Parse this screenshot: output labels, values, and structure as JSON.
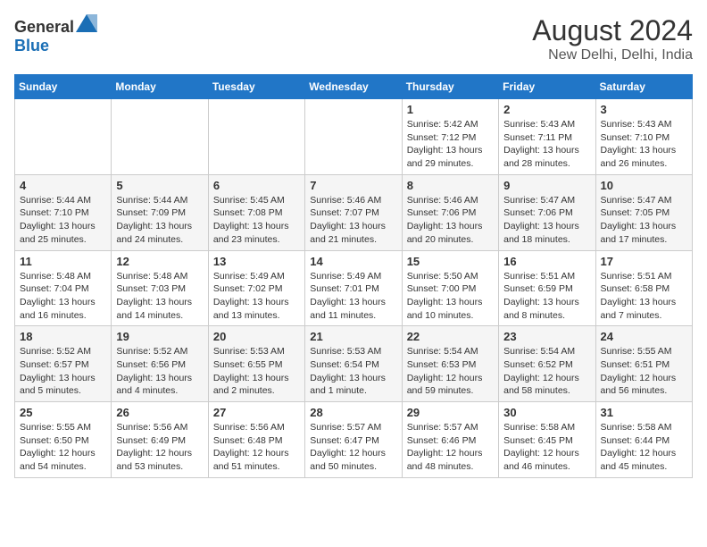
{
  "header": {
    "logo_general": "General",
    "logo_blue": "Blue",
    "title": "August 2024",
    "subtitle": "New Delhi, Delhi, India"
  },
  "columns": [
    "Sunday",
    "Monday",
    "Tuesday",
    "Wednesday",
    "Thursday",
    "Friday",
    "Saturday"
  ],
  "weeks": [
    [
      {
        "day": "",
        "info": ""
      },
      {
        "day": "",
        "info": ""
      },
      {
        "day": "",
        "info": ""
      },
      {
        "day": "",
        "info": ""
      },
      {
        "day": "1",
        "info": "Sunrise: 5:42 AM\nSunset: 7:12 PM\nDaylight: 13 hours\nand 29 minutes."
      },
      {
        "day": "2",
        "info": "Sunrise: 5:43 AM\nSunset: 7:11 PM\nDaylight: 13 hours\nand 28 minutes."
      },
      {
        "day": "3",
        "info": "Sunrise: 5:43 AM\nSunset: 7:10 PM\nDaylight: 13 hours\nand 26 minutes."
      }
    ],
    [
      {
        "day": "4",
        "info": "Sunrise: 5:44 AM\nSunset: 7:10 PM\nDaylight: 13 hours\nand 25 minutes."
      },
      {
        "day": "5",
        "info": "Sunrise: 5:44 AM\nSunset: 7:09 PM\nDaylight: 13 hours\nand 24 minutes."
      },
      {
        "day": "6",
        "info": "Sunrise: 5:45 AM\nSunset: 7:08 PM\nDaylight: 13 hours\nand 23 minutes."
      },
      {
        "day": "7",
        "info": "Sunrise: 5:46 AM\nSunset: 7:07 PM\nDaylight: 13 hours\nand 21 minutes."
      },
      {
        "day": "8",
        "info": "Sunrise: 5:46 AM\nSunset: 7:06 PM\nDaylight: 13 hours\nand 20 minutes."
      },
      {
        "day": "9",
        "info": "Sunrise: 5:47 AM\nSunset: 7:06 PM\nDaylight: 13 hours\nand 18 minutes."
      },
      {
        "day": "10",
        "info": "Sunrise: 5:47 AM\nSunset: 7:05 PM\nDaylight: 13 hours\nand 17 minutes."
      }
    ],
    [
      {
        "day": "11",
        "info": "Sunrise: 5:48 AM\nSunset: 7:04 PM\nDaylight: 13 hours\nand 16 minutes."
      },
      {
        "day": "12",
        "info": "Sunrise: 5:48 AM\nSunset: 7:03 PM\nDaylight: 13 hours\nand 14 minutes."
      },
      {
        "day": "13",
        "info": "Sunrise: 5:49 AM\nSunset: 7:02 PM\nDaylight: 13 hours\nand 13 minutes."
      },
      {
        "day": "14",
        "info": "Sunrise: 5:49 AM\nSunset: 7:01 PM\nDaylight: 13 hours\nand 11 minutes."
      },
      {
        "day": "15",
        "info": "Sunrise: 5:50 AM\nSunset: 7:00 PM\nDaylight: 13 hours\nand 10 minutes."
      },
      {
        "day": "16",
        "info": "Sunrise: 5:51 AM\nSunset: 6:59 PM\nDaylight: 13 hours\nand 8 minutes."
      },
      {
        "day": "17",
        "info": "Sunrise: 5:51 AM\nSunset: 6:58 PM\nDaylight: 13 hours\nand 7 minutes."
      }
    ],
    [
      {
        "day": "18",
        "info": "Sunrise: 5:52 AM\nSunset: 6:57 PM\nDaylight: 13 hours\nand 5 minutes."
      },
      {
        "day": "19",
        "info": "Sunrise: 5:52 AM\nSunset: 6:56 PM\nDaylight: 13 hours\nand 4 minutes."
      },
      {
        "day": "20",
        "info": "Sunrise: 5:53 AM\nSunset: 6:55 PM\nDaylight: 13 hours\nand 2 minutes."
      },
      {
        "day": "21",
        "info": "Sunrise: 5:53 AM\nSunset: 6:54 PM\nDaylight: 13 hours\nand 1 minute."
      },
      {
        "day": "22",
        "info": "Sunrise: 5:54 AM\nSunset: 6:53 PM\nDaylight: 12 hours\nand 59 minutes."
      },
      {
        "day": "23",
        "info": "Sunrise: 5:54 AM\nSunset: 6:52 PM\nDaylight: 12 hours\nand 58 minutes."
      },
      {
        "day": "24",
        "info": "Sunrise: 5:55 AM\nSunset: 6:51 PM\nDaylight: 12 hours\nand 56 minutes."
      }
    ],
    [
      {
        "day": "25",
        "info": "Sunrise: 5:55 AM\nSunset: 6:50 PM\nDaylight: 12 hours\nand 54 minutes."
      },
      {
        "day": "26",
        "info": "Sunrise: 5:56 AM\nSunset: 6:49 PM\nDaylight: 12 hours\nand 53 minutes."
      },
      {
        "day": "27",
        "info": "Sunrise: 5:56 AM\nSunset: 6:48 PM\nDaylight: 12 hours\nand 51 minutes."
      },
      {
        "day": "28",
        "info": "Sunrise: 5:57 AM\nSunset: 6:47 PM\nDaylight: 12 hours\nand 50 minutes."
      },
      {
        "day": "29",
        "info": "Sunrise: 5:57 AM\nSunset: 6:46 PM\nDaylight: 12 hours\nand 48 minutes."
      },
      {
        "day": "30",
        "info": "Sunrise: 5:58 AM\nSunset: 6:45 PM\nDaylight: 12 hours\nand 46 minutes."
      },
      {
        "day": "31",
        "info": "Sunrise: 5:58 AM\nSunset: 6:44 PM\nDaylight: 12 hours\nand 45 minutes."
      }
    ]
  ]
}
